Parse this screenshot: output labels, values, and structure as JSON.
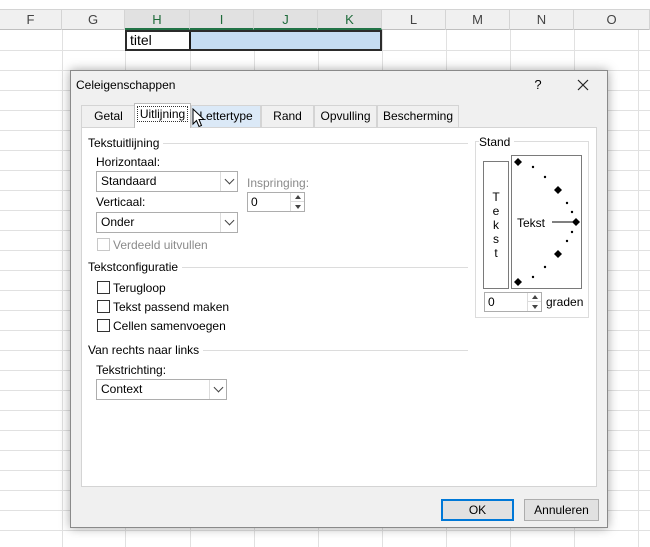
{
  "spreadsheet": {
    "columns": [
      {
        "letter": "F",
        "selected": false
      },
      {
        "letter": "G",
        "selected": false
      },
      {
        "letter": "H",
        "selected": true
      },
      {
        "letter": "I",
        "selected": true
      },
      {
        "letter": "J",
        "selected": true
      },
      {
        "letter": "K",
        "selected": true
      },
      {
        "letter": "L",
        "selected": false
      },
      {
        "letter": "M",
        "selected": false
      },
      {
        "letter": "N",
        "selected": false
      },
      {
        "letter": "O",
        "selected": false
      }
    ],
    "active_cell_value": "titel",
    "selection_color": "#c5dcf2"
  },
  "dialog": {
    "title": "Celeigenschappen",
    "help_label": "?",
    "close_label": "✕",
    "tabs": [
      {
        "label": "Getal",
        "active": false
      },
      {
        "label": "Uitlijning",
        "active": true
      },
      {
        "label": "Lettertype",
        "active": false,
        "hover": true
      },
      {
        "label": "Rand",
        "active": false
      },
      {
        "label": "Opvulling",
        "active": false
      },
      {
        "label": "Bescherming",
        "active": false
      }
    ],
    "alignment": {
      "group_title": "Tekstuitlijning",
      "horizontal_label": "Horizontaal:",
      "horizontal_value": "Standaard",
      "vertical_label": "Verticaal:",
      "vertical_value": "Onder",
      "indent_label": "Inspringing:",
      "indent_value": "0",
      "distributed_label": "Verdeeld uitvullen"
    },
    "text_control": {
      "group_title": "Tekstconfiguratie",
      "wrap_label": "Terugloop",
      "shrink_label": "Tekst passend maken",
      "merge_label": "Cellen samenvoegen"
    },
    "rtl": {
      "group_title": "Van rechts naar links",
      "direction_label": "Tekstrichting:",
      "direction_value": "Context"
    },
    "orientation": {
      "group_title": "Stand",
      "vertical_letters": [
        "T",
        "e",
        "k",
        "s",
        "t"
      ],
      "dial_label": "Tekst",
      "degrees_value": "0",
      "degrees_label": "graden"
    },
    "ok_label": "OK",
    "cancel_label": "Annuleren"
  }
}
